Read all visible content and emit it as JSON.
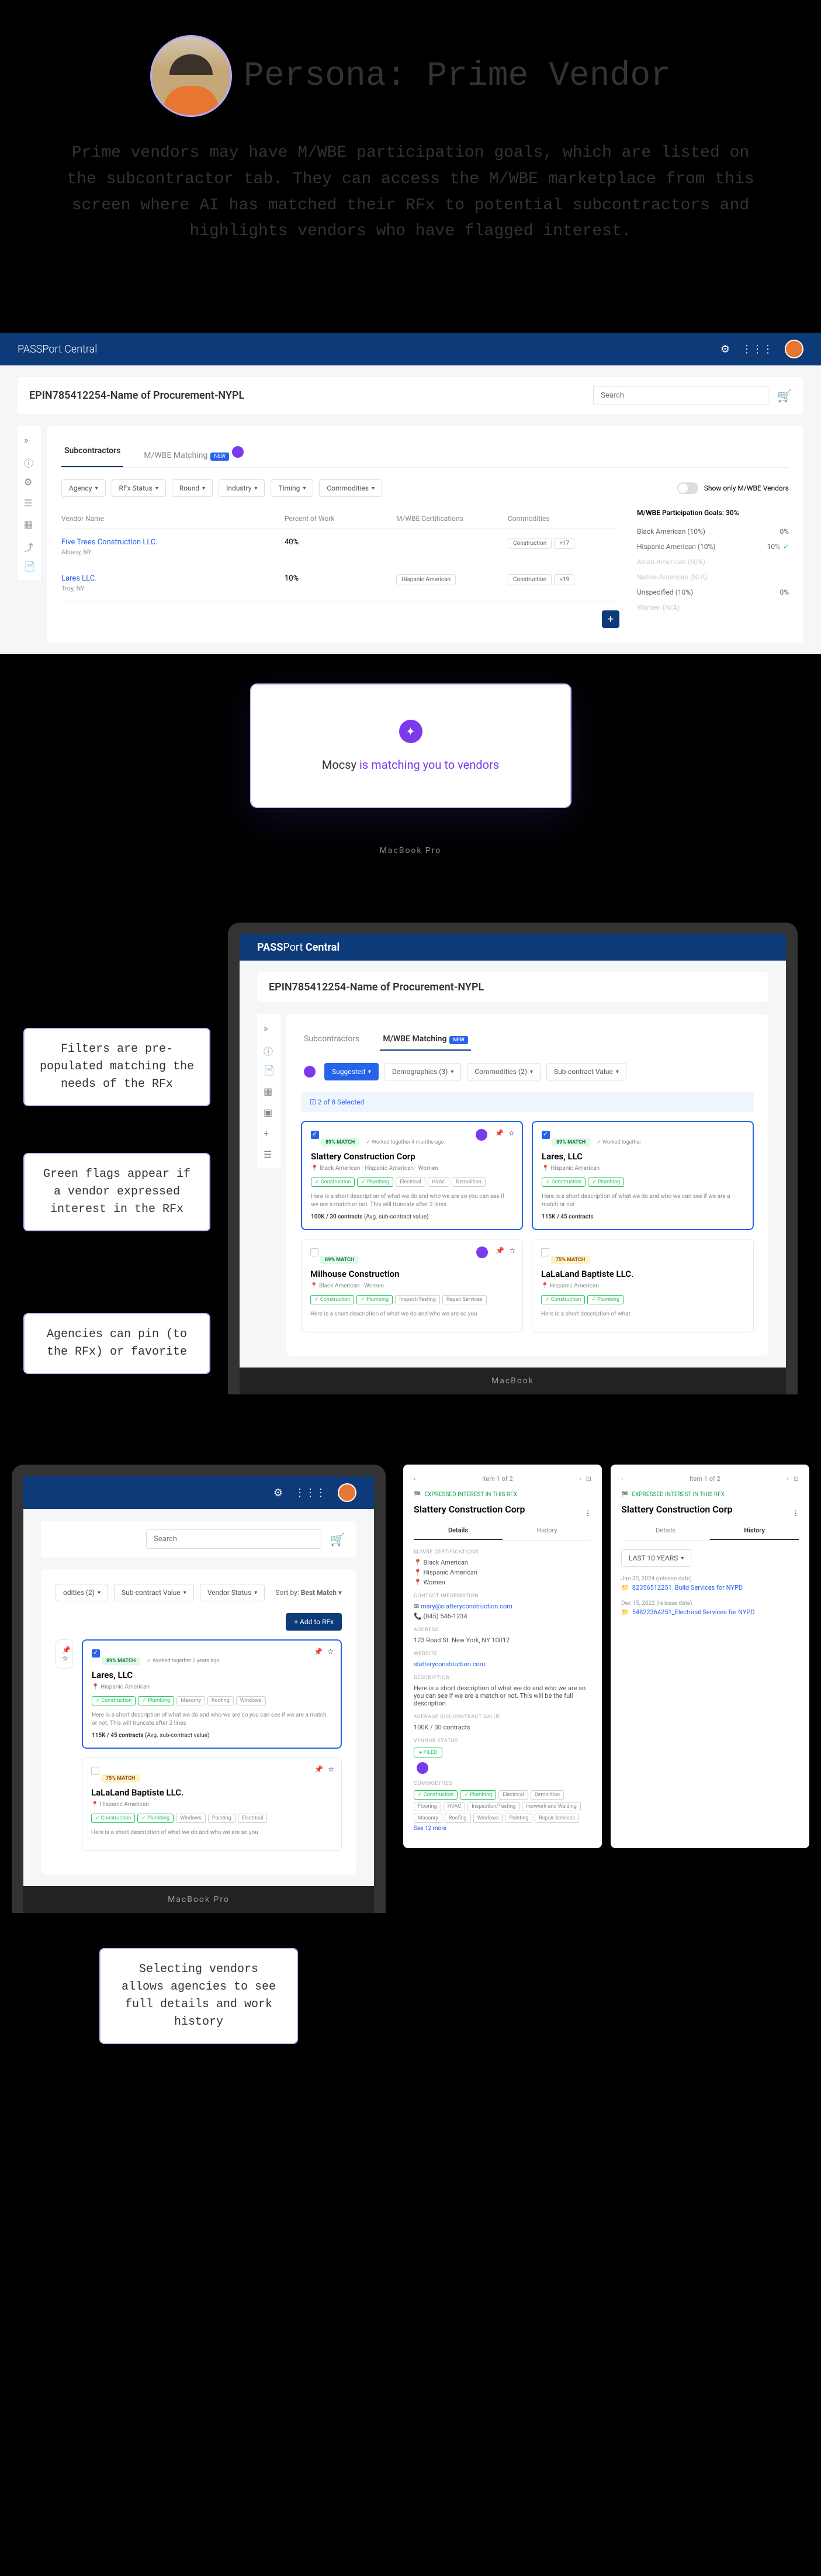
{
  "persona": {
    "title": "Persona: Prime Vendor",
    "description": "Prime vendors may have M/WBE participation goals, which are listed on the subcontractor tab. They can access the M/WBE marketplace from this screen where AI has matched their RFx to potential subcontractors and highlights vendors who have flagged interest."
  },
  "app": {
    "name": "PASSPort Central",
    "procurement_title": "EPIN785412254-Name of Procurement-NYPL",
    "search_placeholder": "Search"
  },
  "tabs": {
    "subcontractors": "Subcontractors",
    "matching": "M/WBE Matching",
    "new_badge": "NEW"
  },
  "filters": {
    "agency": "Agency",
    "rfx_status": "RFx Status",
    "round": "Round",
    "industry": "Industry",
    "timing": "Timing",
    "commodities": "Commodities",
    "suggested": "Suggested",
    "demographics": "Demographics (3)",
    "commodities2": "Commodities (2)",
    "subcontract": "Sub-contract Value",
    "vendor_status": "Vendor Status",
    "show_only": "Show only M/WBE Vendors"
  },
  "table": {
    "headers": {
      "vendor_name": "Vendor Name",
      "percent": "Percent of Work",
      "certs": "M/WBE Certifications",
      "commodities": "Commodities"
    },
    "rows": [
      {
        "name": "Five Trees Construction LLC.",
        "loc": "Albany, NY",
        "percent": "40%",
        "certs": "",
        "commodities": "Construction",
        "extra": "+17"
      },
      {
        "name": "Lares LLC.",
        "loc": "Troy, NY",
        "percent": "10%",
        "certs": "Hispanic American",
        "commodities": "Construction",
        "extra": "+19"
      }
    ]
  },
  "goals": {
    "title": "M/WBE Participation Goals: 30%",
    "items": [
      {
        "label": "Black American (10%)",
        "value": "0%",
        "muted": false
      },
      {
        "label": "Hispanic American (10%)",
        "value": "10%",
        "check": true,
        "muted": false
      },
      {
        "label": "Asian American (N/A)",
        "value": "",
        "muted": true
      },
      {
        "label": "Native American (N/A)",
        "value": "",
        "muted": true
      },
      {
        "label": "Unspecified (10%)",
        "value": "0%",
        "muted": false
      },
      {
        "label": "Women (N/A)",
        "value": "",
        "muted": true
      }
    ]
  },
  "modal": {
    "text_prefix": "Mocsy ",
    "text_highlight": "is matching you to vendors"
  },
  "annotations": {
    "filters": "Filters are pre-populated matching the needs of the RFx",
    "flags": "Green flags appear if a vendor expressed interest in the RFx",
    "pin": "Agencies can pin (to the RFx) or favorite",
    "details": "Selecting vendors allows agencies to see full details and work history"
  },
  "matching": {
    "selected_count": "2 of 8 Selected",
    "sort_label": "Sort by:",
    "sort_value": "Best Match",
    "add_rfx": "+ Add to RFx"
  },
  "vendors": [
    {
      "match": "89% MATCH",
      "worked": "✓ Worked together 4 months ago",
      "name": "Slattery Construction Corp",
      "certs": "Black American · Hispanic American · Women",
      "pills": [
        "Construction",
        "Plumbing"
      ],
      "pills_gray": [
        "Electrical",
        "HVAC",
        "Demolition"
      ],
      "desc": "Here is a short description of what we do and who we are so you can see if we are a match or not. This will truncate after 2 lines",
      "stats": "100K / 30 contracts",
      "stats_sub": "(Avg. sub-contract value)",
      "selected": true,
      "interest": true
    },
    {
      "match": "89% MATCH",
      "worked": "✓ Worked together 2 years ago",
      "name": "Lares, LLC",
      "certs": "Hispanic American",
      "pills": [
        "Construction",
        "Plumbing"
      ],
      "pills_gray": [
        "Masonry",
        "Roofing",
        "Windows"
      ],
      "desc": "Here is a short description of what we do and who we are so you can see if we are a match or not. This will truncate after 2 lines",
      "stats": "115K / 45 contracts",
      "stats_sub": "(Avg. sub-contract value)",
      "selected": true,
      "interest": true
    },
    {
      "match": "89% MATCH",
      "name": "Milhouse Construction",
      "certs": "Black American · Women",
      "pills": [
        "Construction",
        "Plumbing"
      ],
      "pills_gray": [
        "Inspect/Testing",
        "Repair Services"
      ],
      "desc": "Here is a short description of what we do and who we are so you",
      "selected": false
    },
    {
      "match": "75% MATCH",
      "name": "LaLaLand Baptiste LLC.",
      "certs": "Hispanic American",
      "pills": [
        "Construction",
        "Plumbing"
      ],
      "pills_gray": [
        "Windows",
        "Painting",
        "Electrical"
      ],
      "desc": "Here is a short description of what we do and who we are so you",
      "selected": false
    }
  ],
  "detail": {
    "nav": "Item 1 of 2",
    "interest": "EXPRESSED INTEREST IN THIS RFX",
    "title": "Slattery Construction Corp",
    "tab_details": "Details",
    "tab_history": "History",
    "certs_label": "M/WBE CERTIFICATIONS",
    "certs": [
      "Black American",
      "Hispanic American",
      "Women"
    ],
    "contact_label": "CONTACT INFORMATION",
    "email": "mary@slatteryconstruction.com",
    "phone": "(845) 546-1234",
    "address_label": "ADDRESS",
    "address": "123 Road St. New York, NY 10012",
    "website_label": "WEBSITE",
    "website": "slatteryconstruction.com",
    "desc_label": "DESCRIPTION",
    "desc": "Here is a short description of what we do and who we are so you can see if we are a match or not. This will be the full description.",
    "avg_label": "AVERAGE SUB-CONTRACT VALUE",
    "avg": "100K / 30 contracts",
    "status_label": "VENDOR STATUS",
    "status": "FILED",
    "commodities_label": "COMMODITIES",
    "commodities_green": [
      "Construction",
      "Plumbing"
    ],
    "commodities_gray": [
      "Electrical",
      "Demolition",
      "Flooring",
      "HVAC",
      "Inspection/Testing",
      "Ironwork and Welding",
      "Masonry",
      "Roofing",
      "Windows",
      "Painting",
      "Repair Services"
    ],
    "see_more": "See 12 more"
  },
  "history": {
    "filter": "LAST 10 YEARS",
    "items": [
      {
        "date": "Jan 30, 2024 (release date)",
        "link": "82356512251_Build Services for NYPD"
      },
      {
        "date": "Dec 15, 2022 (release date)",
        "link": "54822364251_Electrical Services for NYPD"
      }
    ]
  },
  "macbook": "MacBook Pro"
}
